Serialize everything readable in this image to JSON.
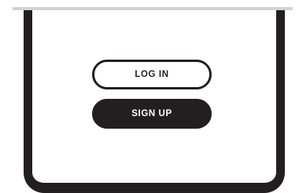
{
  "auth": {
    "login_label": "LOG IN",
    "signup_label": "SIGN UP"
  },
  "colors": {
    "frame": "#231f20",
    "top_bar": "#d2d2d2",
    "background": "#ffffff"
  }
}
